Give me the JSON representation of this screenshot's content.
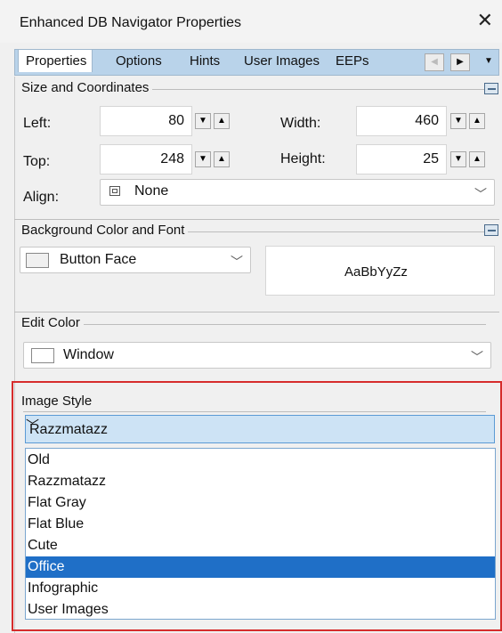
{
  "window": {
    "title": "Enhanced DB Navigator Properties",
    "close_glyph": "✕"
  },
  "tabs": [
    {
      "label": "Properties",
      "active": true
    },
    {
      "label": "Options"
    },
    {
      "label": "Hints"
    },
    {
      "label": "User Images"
    },
    {
      "label": "EEPs"
    }
  ],
  "size_coords": {
    "title": "Size and Coordinates",
    "left_label": "Left:",
    "left_value": "80",
    "top_label": "Top:",
    "top_value": "248",
    "width_label": "Width:",
    "width_value": "460",
    "height_label": "Height:",
    "height_value": "25",
    "align_label": "Align:",
    "align_value": "None"
  },
  "background": {
    "title": "Background Color and Font",
    "color_value": "Button Face",
    "font_preview": "AaBbYyZz"
  },
  "edit_color": {
    "title": "Edit Color",
    "value": "Window"
  },
  "image_style": {
    "title": "Image Style",
    "selected": "Razzmatazz",
    "options": [
      "Old",
      "Razzmatazz",
      "Flat Gray",
      "Flat Blue",
      "Cute",
      "Office",
      "Infographic",
      "User Images"
    ],
    "highlighted_option": "Office",
    "highlight_color": "#d62c2c"
  }
}
